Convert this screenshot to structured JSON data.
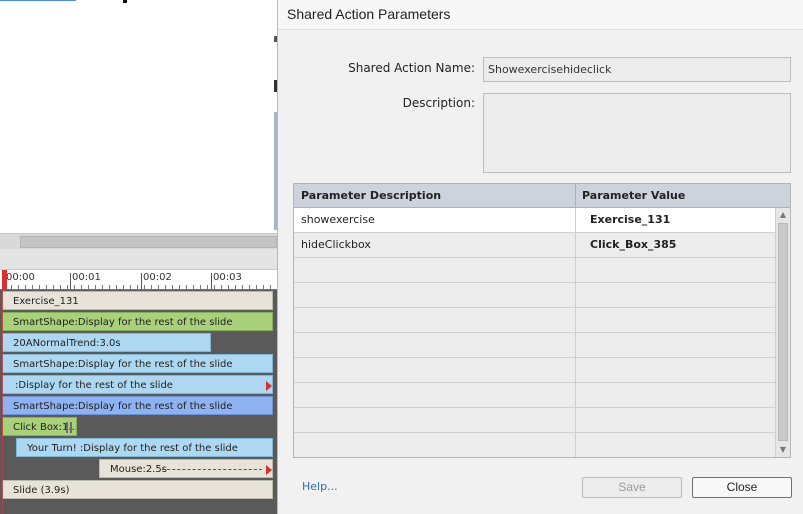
{
  "dialog": {
    "title": "Shared Action Parameters",
    "name_label": "Shared Action Name:",
    "name_value": "Showexercisehideclick",
    "description_label": "Description:",
    "description_value": "",
    "grid": {
      "headers": [
        "Parameter Description",
        "Parameter Value"
      ],
      "rows": [
        {
          "description": "showexercise",
          "value": "Exercise_131"
        },
        {
          "description": "hideClickbox",
          "value": "Click_Box_385"
        }
      ],
      "empty_rows": 8
    },
    "help_link": "Help...",
    "save_label": "Save",
    "close_label": "Close"
  },
  "timeline": {
    "ruler_labels": [
      "00:00",
      "00:01",
      "00:02",
      "00:03"
    ],
    "tracks": [
      {
        "label": "Exercise_131",
        "style": "plain"
      },
      {
        "label": "SmartShape:Display for the rest of the slide",
        "style": "green"
      },
      {
        "label": "20ANormalTrend:3.0s",
        "style": "blue"
      },
      {
        "label": "SmartShape:Display for the rest of the slide",
        "style": "blue"
      },
      {
        "label": ":Display for the rest of the slide",
        "style": "blue"
      },
      {
        "label": "SmartShape:Display for the rest of the slide",
        "style": "blue2"
      },
      {
        "label": "Click Box:1...",
        "style": "green"
      },
      {
        "label": "Your Turn! :Display for the rest of the slide",
        "style": "blue"
      },
      {
        "label": "Mouse:2.5s",
        "style": "plain"
      },
      {
        "label": "Slide (3.9s)",
        "style": "plain"
      }
    ]
  }
}
